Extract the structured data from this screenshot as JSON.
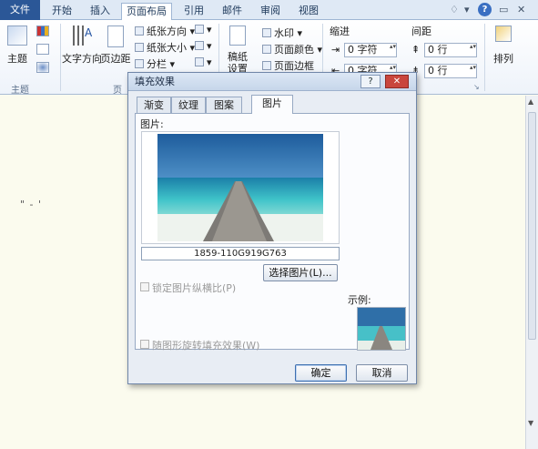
{
  "tabs": [
    "文件",
    "开始",
    "插入",
    "页面布局",
    "引用",
    "邮件",
    "审阅",
    "视图"
  ],
  "window_controls": [
    "♢",
    "▾",
    "?",
    "▭",
    "✕"
  ],
  "ribbon": {
    "theme_group": {
      "button": "主题",
      "label": "主题"
    },
    "page_setup": {
      "text_direction": "文字方向",
      "margins": "页边距",
      "orientation": "纸张方向",
      "size": "纸张大小",
      "columns": "分栏",
      "label_partial": "页"
    },
    "background": {
      "manuscript_line1": "稿纸",
      "manuscript_line2": "设置",
      "watermark": "水印",
      "page_color": "页面颜色",
      "page_borders": "页面边框"
    },
    "indent": {
      "label": "缩进",
      "value1": "0 字符",
      "value2": "0 字符"
    },
    "spacing": {
      "label": "间距",
      "value1": "0 行",
      "value2": "0 行"
    },
    "arrange": {
      "label": "排列"
    }
  },
  "document": {
    "text": "\"   -   '"
  },
  "dialog": {
    "title": "填充效果",
    "help": "?",
    "close": "✕",
    "tabs": [
      "渐变",
      "纹理",
      "图案",
      "图片"
    ],
    "active_tab": "图片",
    "picture_label": "图片:",
    "file_name": "1859-110G919G763",
    "select_button": "选择图片(L)...",
    "lock_aspect": "锁定图片纵横比(P)",
    "rotate_with_shape": "随图形旋转填充效果(W)",
    "sample_label": "示例:",
    "ok": "确定",
    "cancel": "取消"
  },
  "colors": {
    "file_tab": "#2b5797",
    "ribbon_bg": "#dfe9f5",
    "document_bg": "#fbfbee",
    "dialog_bg": "#e8edf4"
  }
}
